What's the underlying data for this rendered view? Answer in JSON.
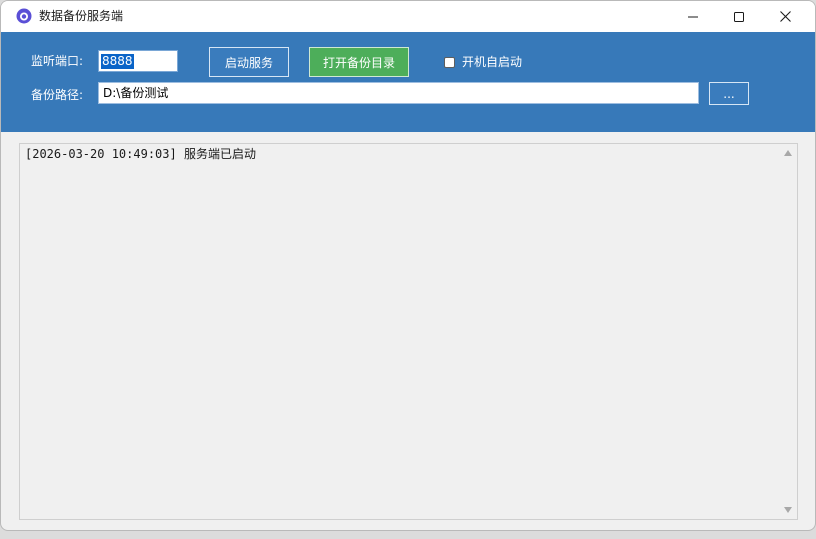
{
  "window": {
    "title": "数据备份服务端",
    "controls": {
      "minimize": "minimize-icon",
      "maximize": "maximize-icon",
      "close": "close-icon"
    }
  },
  "colors": {
    "panel_bg": "#3779b9",
    "start_button_bg": "#3a7cbd",
    "open_button_bg": "#4dae5a",
    "selection": "#0a64c8"
  },
  "config": {
    "port_label": "监听端口:",
    "port_value": "8888",
    "start_button": "启动服务",
    "open_dir_button": "打开备份目录",
    "autostart_label": "开机自启动",
    "autostart_checked": false,
    "path_label": "备份路径:",
    "path_value": "D:\\备份测试",
    "browse_button": "..."
  },
  "log": {
    "lines": [
      "[2026-03-20 10:49:03] 服务端已启动"
    ]
  }
}
